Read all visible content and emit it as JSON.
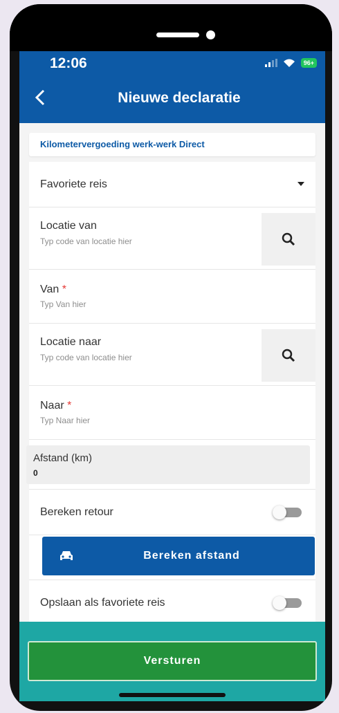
{
  "status_bar": {
    "time": "12:06",
    "battery": "96+"
  },
  "header": {
    "title": "Nieuwe declaratie"
  },
  "declaration_type": "Kilometervergoeding werk-werk Direct",
  "form": {
    "favorite_trip": {
      "label": "Favoriete reis"
    },
    "location_from": {
      "label": "Locatie van",
      "placeholder": "Typ code van locatie hier"
    },
    "from": {
      "label": "Van",
      "required": "*",
      "placeholder": "Typ Van hier"
    },
    "location_to": {
      "label": "Locatie naar",
      "placeholder": "Typ code van locatie hier"
    },
    "to": {
      "label": "Naar",
      "required": "*",
      "placeholder": "Typ Naar hier"
    },
    "distance": {
      "label": "Afstand (km)",
      "value": "0"
    },
    "calc_return": {
      "label": "Bereken retour"
    },
    "calc_button": "Bereken afstand",
    "save_favorite": {
      "label": "Opslaan als favoriete reis"
    }
  },
  "submit_button": "Versturen",
  "colors": {
    "header": "#0d5aa6",
    "submit": "#23923b",
    "highlight": "#1ea7a4"
  }
}
